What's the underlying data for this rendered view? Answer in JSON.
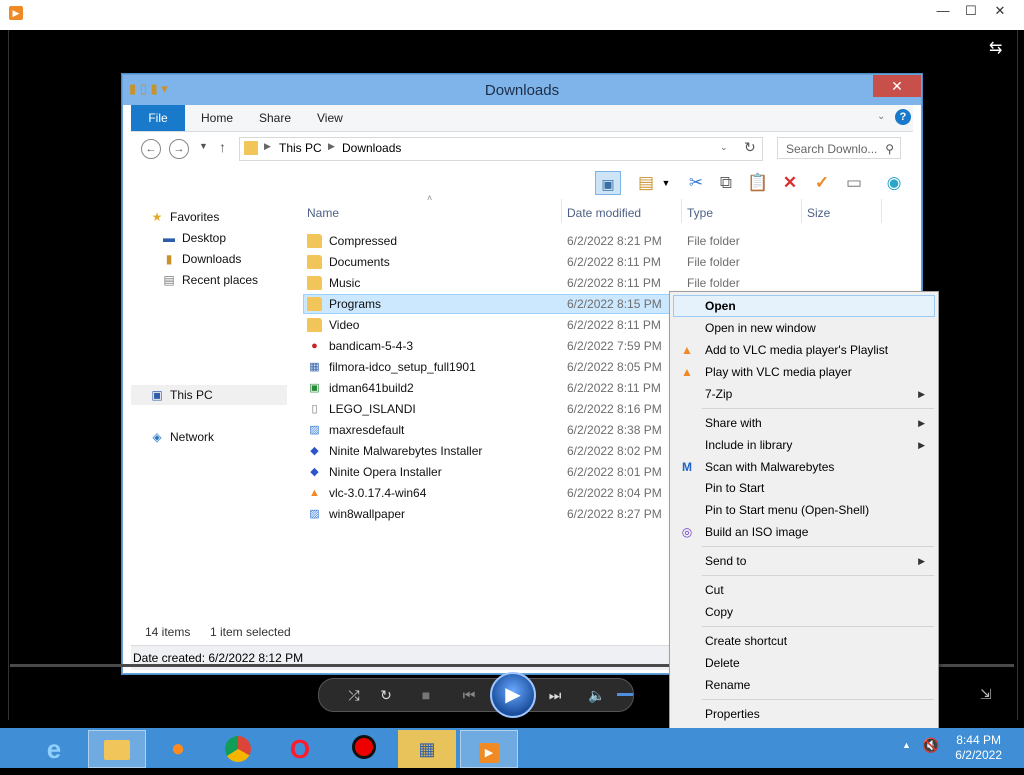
{
  "explorer": {
    "title": "Downloads",
    "close_glyph": "✕",
    "ribbon": {
      "file": "File",
      "home": "Home",
      "share": "Share",
      "view": "View"
    },
    "breadcrumb": [
      "This PC",
      "Downloads"
    ],
    "search_placeholder": "Search Downlo...",
    "nav": {
      "favorites": "Favorites",
      "desktop": "Desktop",
      "downloads": "Downloads",
      "recent": "Recent places",
      "this_pc": "This PC",
      "network": "Network"
    },
    "columns": {
      "name": "Name",
      "date": "Date modified",
      "type": "Type",
      "size": "Size"
    },
    "files": [
      {
        "name": "Compressed",
        "date": "6/2/2022 8:21 PM",
        "type": "File folder"
      },
      {
        "name": "Documents",
        "date": "6/2/2022 8:11 PM",
        "type": "File folder"
      },
      {
        "name": "Music",
        "date": "6/2/2022 8:11 PM",
        "type": "File folder"
      },
      {
        "name": "Programs",
        "date": "6/2/2022 8:15 PM",
        "type": ""
      },
      {
        "name": "Video",
        "date": "6/2/2022 8:11 PM",
        "type": ""
      },
      {
        "name": "bandicam-5-4-3",
        "date": "6/2/2022 7:59 PM",
        "type": ""
      },
      {
        "name": "filmora-idco_setup_full1901",
        "date": "6/2/2022 8:05 PM",
        "type": ""
      },
      {
        "name": "idman641build2",
        "date": "6/2/2022 8:11 PM",
        "type": ""
      },
      {
        "name": "LEGO_ISLANDI",
        "date": "6/2/2022 8:16 PM",
        "type": ""
      },
      {
        "name": "maxresdefault",
        "date": "6/2/2022 8:38 PM",
        "type": ""
      },
      {
        "name": "Ninite Malwarebytes Installer",
        "date": "6/2/2022 8:02 PM",
        "type": ""
      },
      {
        "name": "Ninite Opera Installer",
        "date": "6/2/2022 8:01 PM",
        "type": ""
      },
      {
        "name": "vlc-3.0.17.4-win64",
        "date": "6/2/2022 8:04 PM",
        "type": ""
      },
      {
        "name": "win8wallpaper",
        "date": "6/2/2022 8:27 PM",
        "type": ""
      }
    ],
    "status": {
      "items": "14 items",
      "selected": "1 item selected"
    },
    "details": "Date created: 6/2/2022 8:12 PM"
  },
  "context_menu": {
    "open": "Open",
    "open_new_window": "Open in new window",
    "vlc_playlist": "Add to VLC media player's Playlist",
    "vlc_play": "Play with VLC media player",
    "seven_zip": "7-Zip",
    "share_with": "Share with",
    "include_library": "Include in library",
    "scan_malwarebytes": "Scan with Malwarebytes",
    "pin_start": "Pin to Start",
    "pin_start_menu": "Pin to Start menu (Open-Shell)",
    "build_iso": "Build an ISO image",
    "send_to": "Send to",
    "cut": "Cut",
    "copy": "Copy",
    "create_shortcut": "Create shortcut",
    "delete": "Delete",
    "rename": "Rename",
    "properties": "Properties"
  },
  "taskbar": {
    "time": "8:44 PM",
    "date": "6/2/2022"
  },
  "colors": {
    "accent": "#1979ca",
    "taskbar": "#3f8ed6",
    "titlebar": "#7eb4ea",
    "selection": "#cce8ff"
  }
}
